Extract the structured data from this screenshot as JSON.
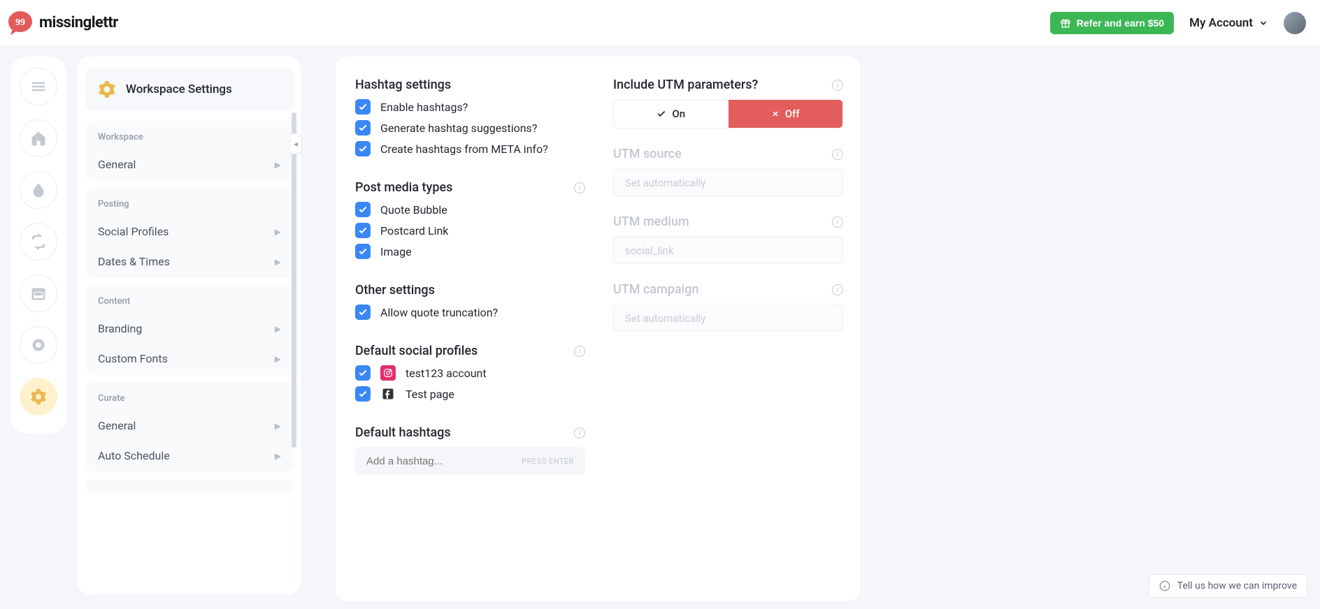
{
  "brand": "missinglettr",
  "header": {
    "refer_label": "Refer and earn $50",
    "account_label": "My Account"
  },
  "sidebar": {
    "title": "Workspace Settings",
    "groups": [
      {
        "label": "Workspace",
        "items": [
          {
            "label": "General"
          }
        ]
      },
      {
        "label": "Posting",
        "items": [
          {
            "label": "Social Profiles"
          },
          {
            "label": "Dates & Times"
          }
        ]
      },
      {
        "label": "Content",
        "items": [
          {
            "label": "Branding"
          },
          {
            "label": "Custom Fonts"
          }
        ]
      },
      {
        "label": "Curate",
        "items": [
          {
            "label": "General"
          },
          {
            "label": "Auto Schedule"
          }
        ]
      }
    ]
  },
  "settings": {
    "hashtag": {
      "title": "Hashtag settings",
      "items": [
        "Enable hashtags?",
        "Generate hashtag suggestions?",
        "Create hashtags from META info?"
      ]
    },
    "media": {
      "title": "Post media types",
      "items": [
        "Quote Bubble",
        "Postcard Link",
        "Image"
      ]
    },
    "other": {
      "title": "Other settings",
      "items": [
        "Allow quote truncation?"
      ]
    },
    "profiles": {
      "title": "Default social profiles",
      "items": [
        "test123 account",
        "Test page"
      ]
    },
    "default_hashtags": {
      "title": "Default hashtags",
      "placeholder": "Add a hashtag...",
      "hint": "PRESS ENTER"
    },
    "utm": {
      "title": "Include UTM parameters?",
      "toggle": {
        "on": "On",
        "off": "Off"
      },
      "fields": [
        {
          "label": "UTM source",
          "placeholder": "Set automatically"
        },
        {
          "label": "UTM medium",
          "placeholder": "social_link"
        },
        {
          "label": "UTM campaign",
          "placeholder": "Set automatically"
        }
      ]
    }
  },
  "feedback": "Tell us how we can improve"
}
